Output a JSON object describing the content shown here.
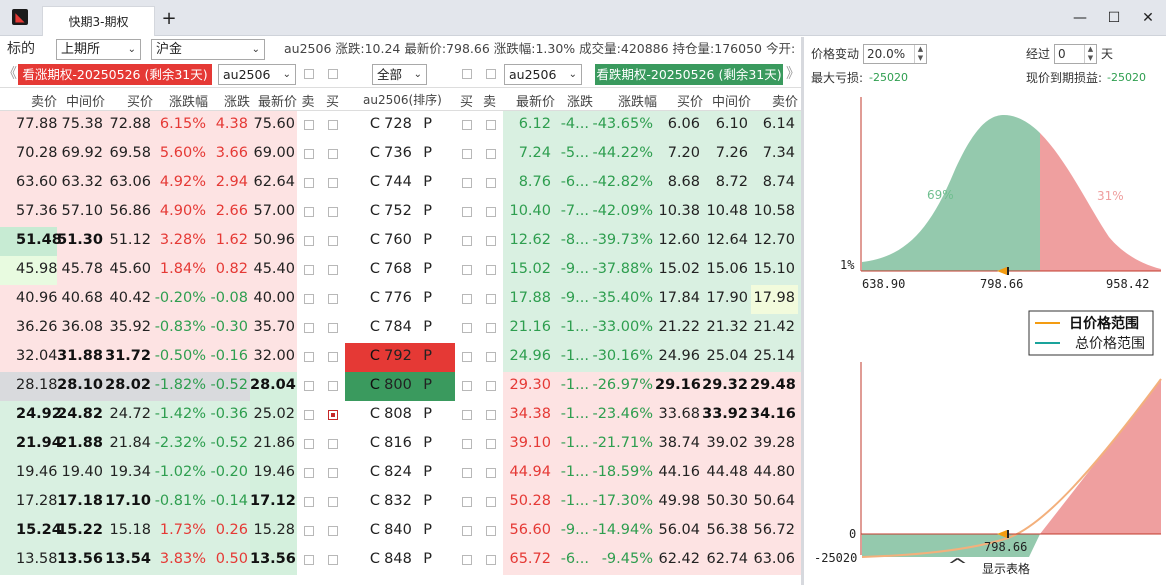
{
  "window": {
    "tab_title": "快期3-期权",
    "app_icon": "app-logo-icon",
    "add_tab": "+",
    "minimize": "—",
    "maximize": "☐",
    "close": "✕"
  },
  "toolbar": {
    "label_target": "标的",
    "exchange": "上期所",
    "product": "沪金",
    "info": "au2506 涨跌:10.24 最新价:798.66 涨跌幅:1.30% 成交量:420886 持仓量:176050 今开:"
  },
  "selector": {
    "call_badge": "看涨期权-20250526 (剩余31天)",
    "call_contract": "au2506",
    "filter": "全部",
    "put_contract": "au2506",
    "put_badge": "看跌期权-20250526 (剩余31天)",
    "prev": "《",
    "next": "》"
  },
  "headers": [
    "卖价",
    "中间价",
    "买价",
    "涨跌幅",
    "涨跌",
    "最新价",
    "卖",
    "买",
    "au2506(排序)",
    "买",
    "卖",
    "最新价",
    "涨跌",
    "涨跌幅",
    "买价",
    "中间价",
    "卖价"
  ],
  "colors": {
    "up_red": "#e53935",
    "down_green": "#2e9e4f",
    "call_bg": "#fde3e3",
    "put_bg": "#d9f0e1"
  },
  "rows": [
    {
      "c_ask": "77.88",
      "c_mid": "75.38",
      "c_bid": "72.88",
      "c_pct": "6.15%",
      "c_chg": "4.38",
      "c_last": "75.60",
      "strike": "728",
      "p_last": "6.12",
      "p_chg": "-4...",
      "p_pct": "-43.65%",
      "p_bid": "6.06",
      "p_mid": "6.10",
      "p_ask": "6.14"
    },
    {
      "c_ask": "70.28",
      "c_mid": "69.92",
      "c_bid": "69.58",
      "c_pct": "5.60%",
      "c_chg": "3.66",
      "c_last": "69.00",
      "strike": "736",
      "p_last": "7.24",
      "p_chg": "-5...",
      "p_pct": "-44.22%",
      "p_bid": "7.20",
      "p_mid": "7.26",
      "p_ask": "7.34"
    },
    {
      "c_ask": "63.60",
      "c_mid": "63.32",
      "c_bid": "63.06",
      "c_pct": "4.92%",
      "c_chg": "2.94",
      "c_last": "62.64",
      "strike": "744",
      "p_last": "8.76",
      "p_chg": "-6...",
      "p_pct": "-42.82%",
      "p_bid": "8.68",
      "p_mid": "8.72",
      "p_ask": "8.74"
    },
    {
      "c_ask": "57.36",
      "c_mid": "57.10",
      "c_bid": "56.86",
      "c_pct": "4.90%",
      "c_chg": "2.66",
      "c_last": "57.00",
      "strike": "752",
      "p_last": "10.40",
      "p_chg": "-7...",
      "p_pct": "-42.09%",
      "p_bid": "10.38",
      "p_mid": "10.48",
      "p_ask": "10.58"
    },
    {
      "c_ask": "51.48",
      "c_mid": "51.30",
      "c_bid": "51.12",
      "c_pct": "3.28%",
      "c_chg": "1.62",
      "c_last": "50.96",
      "strike": "760",
      "p_last": "12.62",
      "p_chg": "-8...",
      "p_pct": "-39.73%",
      "p_bid": "12.60",
      "p_mid": "12.64",
      "p_ask": "12.70"
    },
    {
      "c_ask": "45.98",
      "c_mid": "45.78",
      "c_bid": "45.60",
      "c_pct": "1.84%",
      "c_chg": "0.82",
      "c_last": "45.40",
      "strike": "768",
      "p_last": "15.02",
      "p_chg": "-9...",
      "p_pct": "-37.88%",
      "p_bid": "15.02",
      "p_mid": "15.06",
      "p_ask": "15.10"
    },
    {
      "c_ask": "40.96",
      "c_mid": "40.68",
      "c_bid": "40.42",
      "c_pct": "-0.20%",
      "c_chg": "-0.08",
      "c_last": "40.00",
      "strike": "776",
      "p_last": "17.88",
      "p_chg": "-9...",
      "p_pct": "-35.40%",
      "p_bid": "17.84",
      "p_mid": "17.90",
      "p_ask": "17.98"
    },
    {
      "c_ask": "36.26",
      "c_mid": "36.08",
      "c_bid": "35.92",
      "c_pct": "-0.83%",
      "c_chg": "-0.30",
      "c_last": "35.70",
      "strike": "784",
      "p_last": "21.16",
      "p_chg": "-1...",
      "p_pct": "-33.00%",
      "p_bid": "21.22",
      "p_mid": "21.32",
      "p_ask": "21.42"
    },
    {
      "c_ask": "32.04",
      "c_mid": "31.88",
      "c_bid": "31.72",
      "c_pct": "-0.50%",
      "c_chg": "-0.16",
      "c_last": "32.00",
      "strike": "792",
      "p_last": "24.96",
      "p_chg": "-1...",
      "p_pct": "-30.16%",
      "p_bid": "24.96",
      "p_mid": "25.04",
      "p_ask": "25.14"
    },
    {
      "c_ask": "28.18",
      "c_mid": "28.10",
      "c_bid": "28.02",
      "c_pct": "-1.82%",
      "c_chg": "-0.52",
      "c_last": "28.04",
      "strike": "800",
      "p_last": "29.30",
      "p_chg": "-1...",
      "p_pct": "-26.97%",
      "p_bid": "29.16",
      "p_mid": "29.32",
      "p_ask": "29.48"
    },
    {
      "c_ask": "24.92",
      "c_mid": "24.82",
      "c_bid": "24.72",
      "c_pct": "-1.42%",
      "c_chg": "-0.36",
      "c_last": "25.02",
      "strike": "808",
      "p_last": "34.38",
      "p_chg": "-1...",
      "p_pct": "-23.46%",
      "p_bid": "33.68",
      "p_mid": "33.92",
      "p_ask": "34.16"
    },
    {
      "c_ask": "21.94",
      "c_mid": "21.88",
      "c_bid": "21.84",
      "c_pct": "-2.32%",
      "c_chg": "-0.52",
      "c_last": "21.86",
      "strike": "816",
      "p_last": "39.10",
      "p_chg": "-1...",
      "p_pct": "-21.71%",
      "p_bid": "38.74",
      "p_mid": "39.02",
      "p_ask": "39.28"
    },
    {
      "c_ask": "19.46",
      "c_mid": "19.40",
      "c_bid": "19.34",
      "c_pct": "-1.02%",
      "c_chg": "-0.20",
      "c_last": "19.46",
      "strike": "824",
      "p_last": "44.94",
      "p_chg": "-1...",
      "p_pct": "-18.59%",
      "p_bid": "44.16",
      "p_mid": "44.48",
      "p_ask": "44.80"
    },
    {
      "c_ask": "17.28",
      "c_mid": "17.18",
      "c_bid": "17.10",
      "c_pct": "-0.81%",
      "c_chg": "-0.14",
      "c_last": "17.12",
      "strike": "832",
      "p_last": "50.28",
      "p_chg": "-1...",
      "p_pct": "-17.30%",
      "p_bid": "49.98",
      "p_mid": "50.30",
      "p_ask": "50.64"
    },
    {
      "c_ask": "15.24",
      "c_mid": "15.22",
      "c_bid": "15.18",
      "c_pct": "1.73%",
      "c_chg": "0.26",
      "c_last": "15.28",
      "strike": "840",
      "p_last": "56.60",
      "p_chg": "-9...",
      "p_pct": "-14.94%",
      "p_bid": "56.04",
      "p_mid": "56.38",
      "p_ask": "56.72"
    },
    {
      "c_ask": "13.58",
      "c_mid": "13.56",
      "c_bid": "13.54",
      "c_pct": "3.83%",
      "c_chg": "0.50",
      "c_last": "13.56",
      "strike": "848",
      "p_last": "65.72",
      "p_chg": "-6...",
      "p_pct": "-9.45%",
      "p_bid": "62.42",
      "p_mid": "62.74",
      "p_ask": "63.06"
    }
  ],
  "strike_c": "C",
  "strike_p": "P",
  "panel": {
    "price_change_label": "价格变动",
    "price_change_value": "20.0%",
    "days_label": "经过",
    "days_value": "0",
    "days_unit": "天",
    "max_loss_label": "最大亏损:",
    "max_loss_value": "-25020",
    "expiry_pl_label": "现价到期损益:",
    "expiry_pl_value": "-25020",
    "prob_left": "69%",
    "prob_right": "31%",
    "prob_axis": "1%",
    "x_low": "638.90",
    "x_mid": "798.66",
    "x_high": "958.42",
    "legend_daily": "日价格范围",
    "legend_total": "总价格范围",
    "pl_zero": "0",
    "pl_min": "-25020",
    "pl_x": "798.66",
    "show_table": "显示表格"
  }
}
